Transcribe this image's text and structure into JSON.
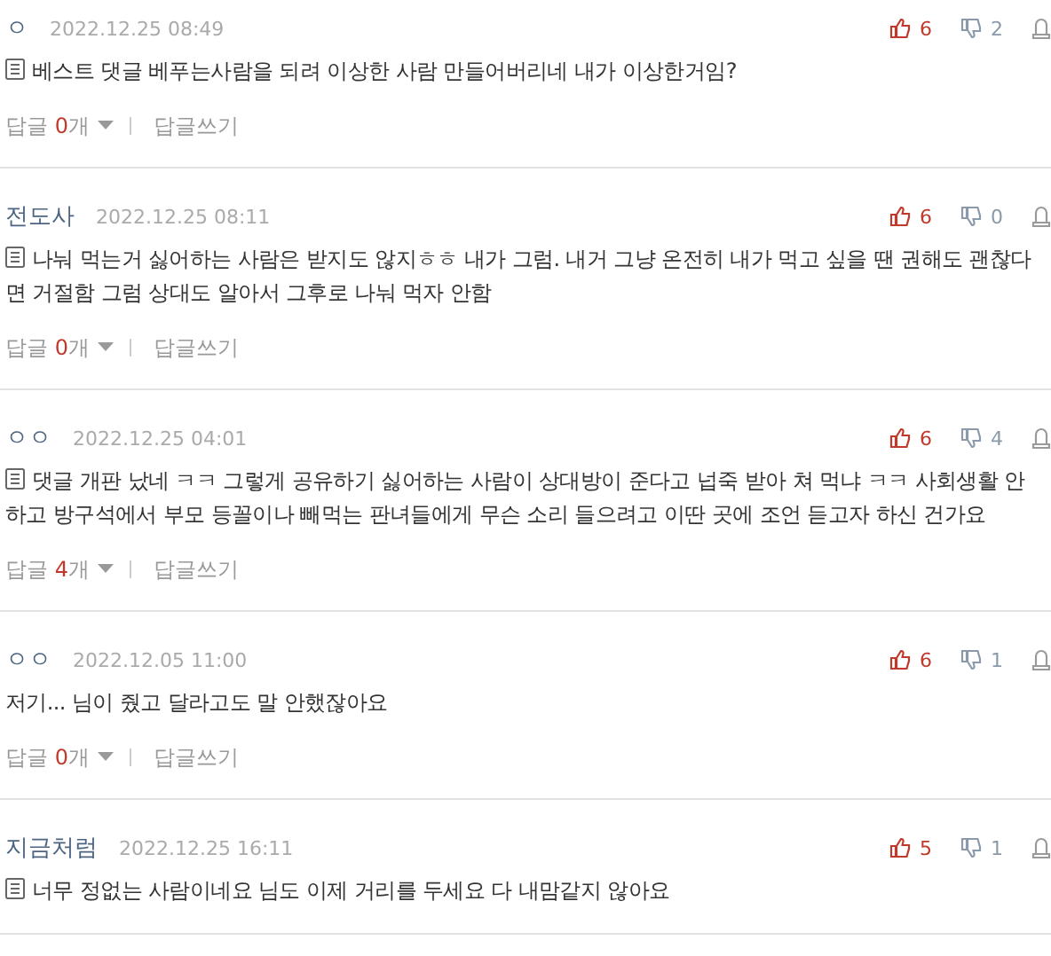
{
  "comments": [
    {
      "author": "ㅇ",
      "date": "2022.12.25 08:49",
      "likes": "6",
      "dislikes": "2",
      "memo_icon": true,
      "text": "베스트 댓글 베푸는사람을 되려 이상한 사람 만들어버리네 내가 이상한거임?",
      "reply_label": "답글",
      "reply_count": "0",
      "reply_unit": "개",
      "write_reply": "답글쓰기"
    },
    {
      "author": "전도사",
      "date": "2022.12.25 08:11",
      "likes": "6",
      "dislikes": "0",
      "memo_icon": true,
      "text": "나눠 먹는거 싫어하는 사람은 받지도 않지ㅎㅎ 내가 그럼. 내거 그냥 온전히 내가 먹고 싶을 땐 권해도 괜찮다면 거절함 그럼 상대도 알아서 그후로 나눠 먹자 안함",
      "reply_label": "답글",
      "reply_count": "0",
      "reply_unit": "개",
      "write_reply": "답글쓰기"
    },
    {
      "author": "ㅇㅇ",
      "date": "2022.12.25 04:01",
      "likes": "6",
      "dislikes": "4",
      "memo_icon": true,
      "text": "댓글 개판 났네 ㅋㅋ 그렇게 공유하기 싫어하는 사람이 상대방이 준다고 넙죽 받아 쳐 먹냐 ㅋㅋ 사회생활 안 하고 방구석에서 부모 등꼴이나 빼먹는 판녀들에게 무슨 소리 들으려고 이딴 곳에 조언 듣고자 하신 건가요",
      "reply_label": "답글",
      "reply_count": "4",
      "reply_unit": "개",
      "write_reply": "답글쓰기"
    },
    {
      "author": "ㅇㅇ",
      "date": "2022.12.05 11:00",
      "likes": "6",
      "dislikes": "1",
      "memo_icon": false,
      "text": "저기... 님이 줬고 달라고도 말 안했잖아요",
      "reply_label": "답글",
      "reply_count": "0",
      "reply_unit": "개",
      "write_reply": "답글쓰기"
    },
    {
      "author": "지금처럼",
      "date": "2022.12.25 16:11",
      "likes": "5",
      "dislikes": "1",
      "memo_icon": true,
      "text": "너무 정없는 사람이네요 님도 이제 거리를 두세요 다 내맘같지 않아요"
    }
  ]
}
